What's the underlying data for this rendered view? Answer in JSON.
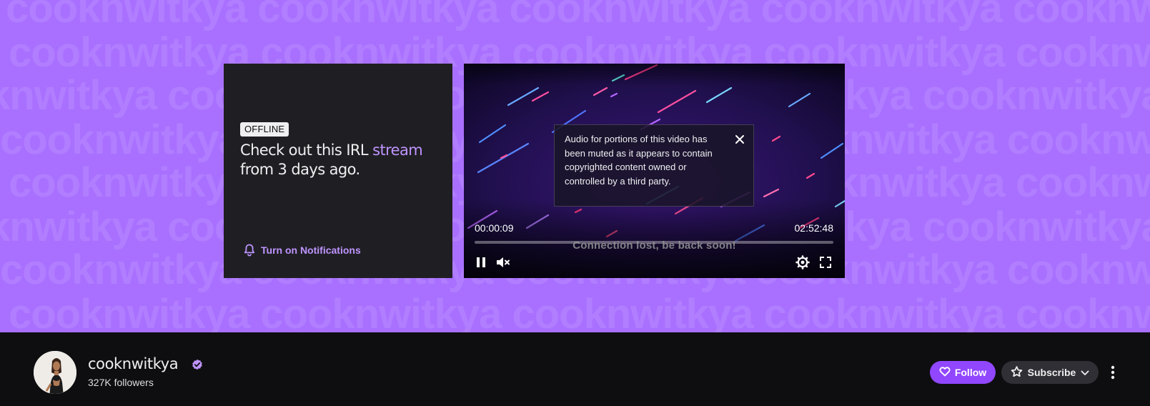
{
  "banner": {
    "watermark_text": "cooknwitkya",
    "background_color": "#a970ff"
  },
  "offline_card": {
    "badge": "OFFLINE",
    "message_prefix": "Check out this IRL",
    "message_link": "stream",
    "message_suffix": "from 3 days ago.",
    "notifications_label": "Turn on Notifications"
  },
  "player": {
    "muted_notice": "Audio for portions of this video has been muted as it appears to contain copyrighted content owned or controlled by a third party.",
    "current_time": "00:00:09",
    "total_time": "02:52:48",
    "status_text": "Connection lost, be back soon!",
    "icons": [
      "close-icon",
      "pause-icon",
      "muted-volume-icon",
      "settings-icon",
      "fullscreen-icon"
    ]
  },
  "channel": {
    "name": "cooknwitkya",
    "followers": "327K followers",
    "verified": true,
    "follow_label": "Follow",
    "subscribe_label": "Subscribe",
    "accent_color": "#9147ff",
    "icons": [
      "heart-icon",
      "star-icon",
      "chevron-down-icon",
      "more-vertical-icon",
      "verified-badge-icon"
    ]
  }
}
